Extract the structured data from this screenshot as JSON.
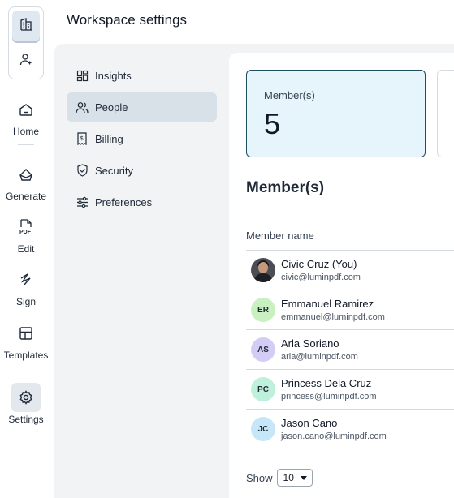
{
  "page_title": "Workspace settings",
  "rail": {
    "items": [
      {
        "label": "Home",
        "icon": "home-icon"
      },
      {
        "label": "Generate",
        "icon": "generate-icon"
      },
      {
        "label": "Edit",
        "icon": "pdf-icon"
      },
      {
        "label": "Sign",
        "icon": "signature-icon"
      },
      {
        "label": "Templates",
        "icon": "templates-icon"
      },
      {
        "label": "Settings",
        "icon": "gear-icon"
      }
    ]
  },
  "settings_menu": {
    "items": [
      {
        "label": "Insights",
        "icon": "insights-icon"
      },
      {
        "label": "People",
        "icon": "people-icon",
        "active": true
      },
      {
        "label": "Billing",
        "icon": "billing-icon"
      },
      {
        "label": "Security",
        "icon": "shield-icon"
      },
      {
        "label": "Preferences",
        "icon": "sliders-icon"
      }
    ]
  },
  "stats": {
    "members_label": "Member(s)",
    "members_value": "5"
  },
  "members": {
    "section_title": "Member(s)",
    "column_header": "Member name",
    "rows": [
      {
        "initials": "",
        "name": "Civic Cruz (You)",
        "email": "civic@luminpdf.com",
        "avatar_color": "#4b4f55",
        "photo": true
      },
      {
        "initials": "ER",
        "name": "Emmanuel Ramirez",
        "email": "emmanuel@luminpdf.com",
        "avatar_color": "#c9f0c0"
      },
      {
        "initials": "AS",
        "name": "Arla Soriano",
        "email": "arla@luminpdf.com",
        "avatar_color": "#d3cdf5"
      },
      {
        "initials": "PC",
        "name": "Princess Dela Cruz",
        "email": "princess@luminpdf.com",
        "avatar_color": "#bff0dc"
      },
      {
        "initials": "JC",
        "name": "Jason Cano",
        "email": "jason.cano@luminpdf.com",
        "avatar_color": "#c6e7f7"
      }
    ]
  },
  "pagination": {
    "show_label": "Show",
    "page_size": "10"
  }
}
